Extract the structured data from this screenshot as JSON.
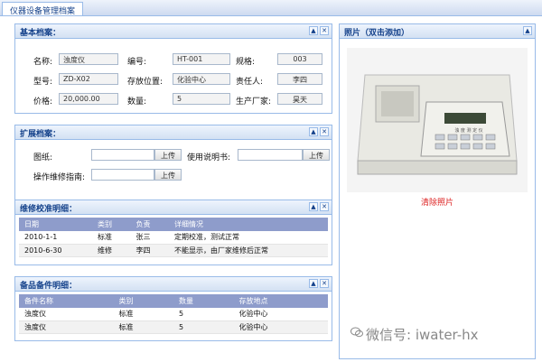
{
  "window": {
    "title": "仪器设备管理档案"
  },
  "basic": {
    "header": "基本档案：",
    "fields": {
      "name_label": "名称:",
      "name_value": "浊度仪",
      "code_label": "编号:",
      "code_value": "HT-001",
      "spec_label": "规格:",
      "spec_value": "003",
      "model_label": "型号:",
      "model_value": "ZD-X02",
      "loc_label": "存放位置:",
      "loc_value": "化验中心",
      "owner_label": "责任人:",
      "owner_value": "李四",
      "price_label": "价格:",
      "price_value": "20,000.00",
      "qty_label": "数量:",
      "qty_value": "5",
      "maker_label": "生产厂家:",
      "maker_value": "昊天"
    }
  },
  "extended": {
    "header": "扩展档案：",
    "drawing_label": "图纸:",
    "manual_label": "使用说明书:",
    "maint_label": "操作维修指南:",
    "upload_label": "上传"
  },
  "maintenance": {
    "header": "维修校准明细：",
    "columns": [
      "日期",
      "类别",
      "负责",
      "详细情况"
    ],
    "rows": [
      [
        "2010-1-1",
        "标准",
        "张三",
        "定期校准，测试正常"
      ],
      [
        "2010-6-30",
        "维修",
        "李四",
        "不能显示，由厂家维修后正常"
      ]
    ]
  },
  "spares": {
    "header": "备品备件明细：",
    "columns": [
      "备件名称",
      "类别",
      "数量",
      "存放地点"
    ],
    "rows": [
      [
        "浊度仪",
        "标准",
        "5",
        "化验中心"
      ],
      [
        "浊度仪",
        "标准",
        "5",
        "化验中心"
      ]
    ]
  },
  "photo": {
    "header": "照片（双击添加）",
    "clear_label": "清除照片",
    "lcd_text": "浊 度 测 定 仪"
  },
  "watermark": {
    "text": "微信号: iwater-hx"
  },
  "colors": {
    "accent": "#15428b",
    "border": "#99bbe8",
    "table_header": "#8e9ccb",
    "link": "#dd2222"
  }
}
